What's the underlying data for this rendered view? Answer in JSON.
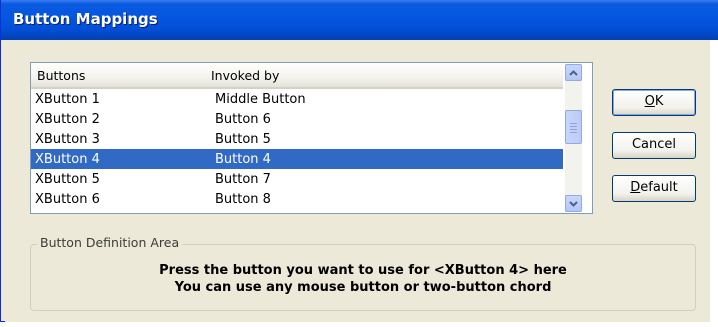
{
  "window": {
    "title": "Button Mappings"
  },
  "list": {
    "headers": [
      "Buttons",
      "Invoked by"
    ],
    "rows": [
      {
        "button": "XButton 1",
        "invoked": "Middle Button",
        "selected": false
      },
      {
        "button": "XButton 2",
        "invoked": "Button 6",
        "selected": false
      },
      {
        "button": "XButton 3",
        "invoked": "Button 5",
        "selected": false
      },
      {
        "button": "XButton 4",
        "invoked": "Button 4",
        "selected": true
      },
      {
        "button": "XButton 5",
        "invoked": "Button 7",
        "selected": false
      },
      {
        "button": "XButton 6",
        "invoked": "Button 8",
        "selected": false
      }
    ]
  },
  "buttons": {
    "ok_prefix": "",
    "ok_mnemonic": "O",
    "ok_rest": "K",
    "cancel": "Cancel",
    "default_mnemonic": "D",
    "default_rest": "efault"
  },
  "group": {
    "label": "Button Definition Area",
    "line1": "Press the button you want to use for <XButton 4> here",
    "line2": "You can use any mouse button or two-button chord"
  },
  "colors": {
    "selection": "#316ac5",
    "titlebar": "#0556e0",
    "face": "#ece9d8"
  }
}
